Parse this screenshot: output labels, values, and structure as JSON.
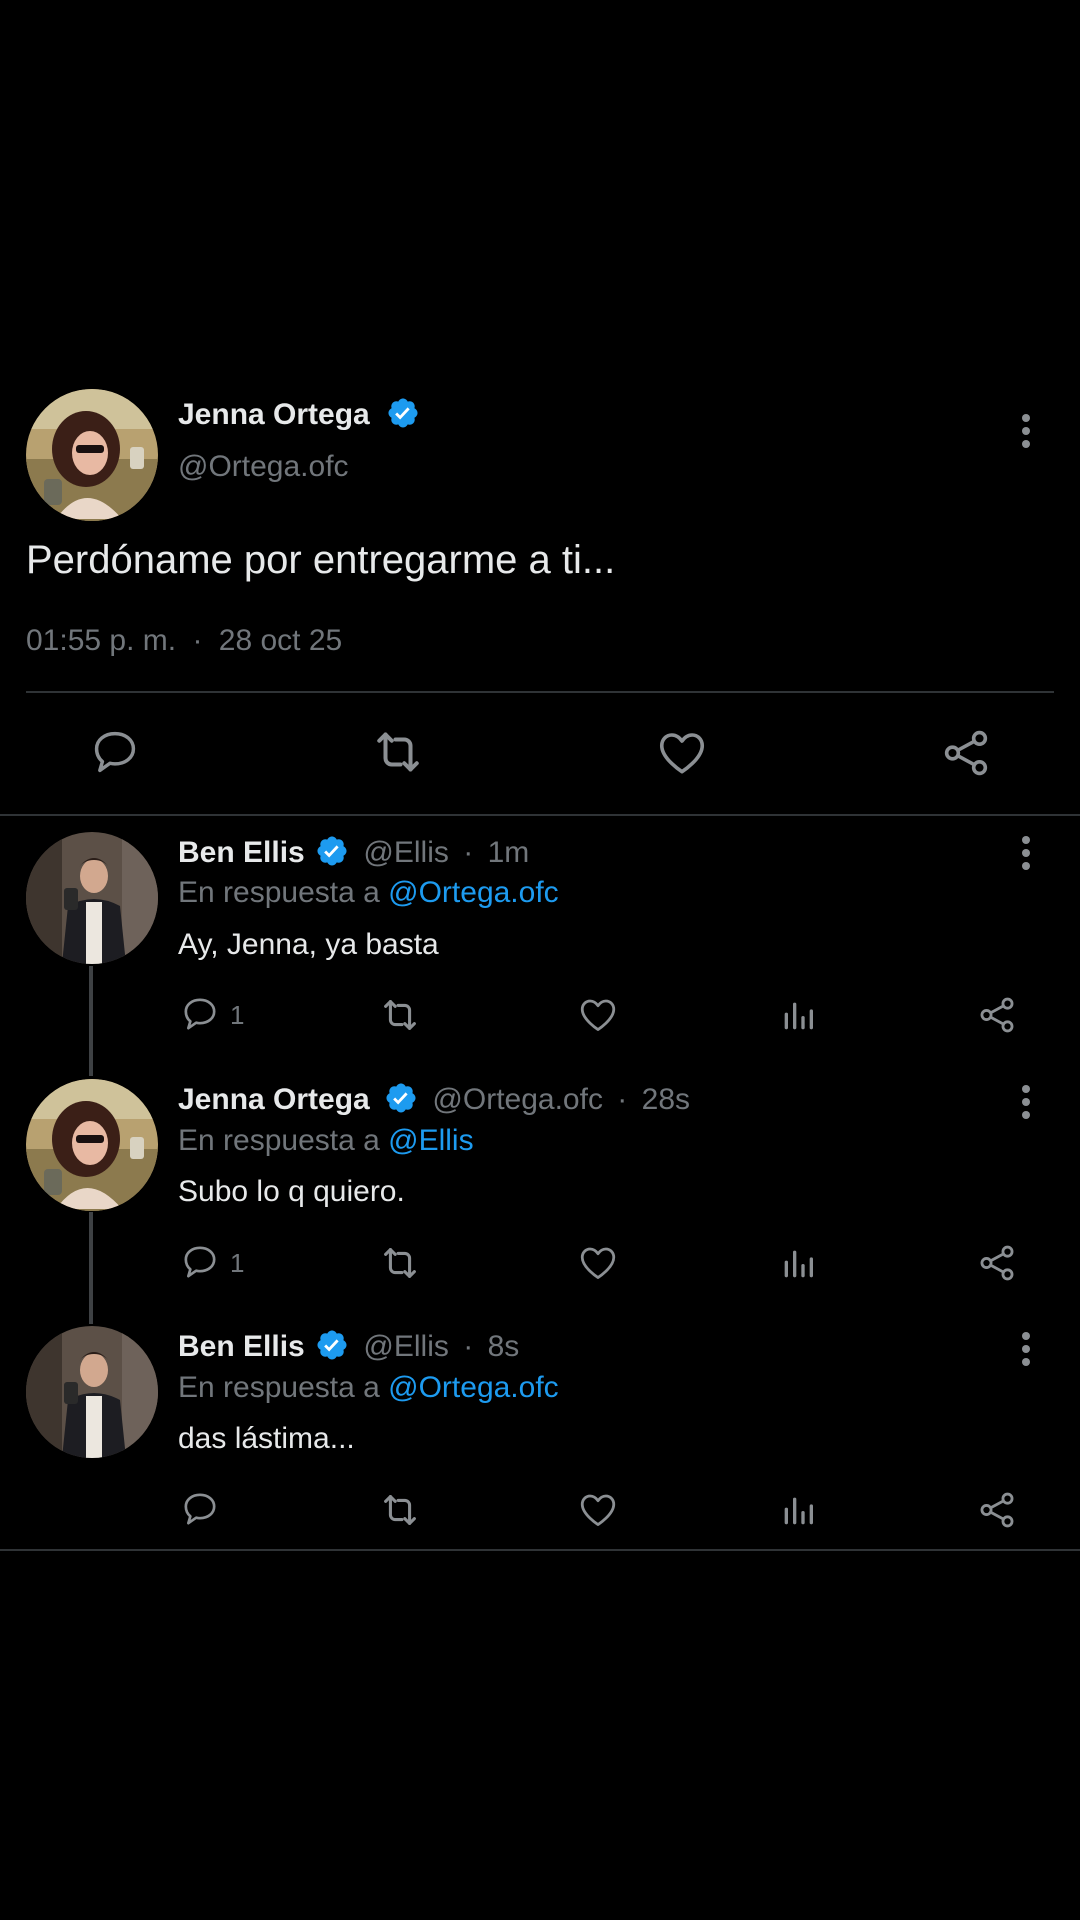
{
  "main_tweet": {
    "author_name": "Jenna Ortega",
    "handle": "@Ortega.ofc",
    "text": "Perdóname por entregarme a ti...",
    "time": "01:55 p. m.",
    "separator": "·",
    "date": "28 oct 25"
  },
  "replies": [
    {
      "author_name": "Ben Ellis",
      "handle": "@Ellis",
      "separator": "·",
      "age": "1m",
      "reply_prefix": "En respuesta a",
      "reply_to": "@Ortega.ofc",
      "text": "Ay, Jenna, ya basta",
      "reply_count": "1"
    },
    {
      "author_name": "Jenna Ortega",
      "handle": "@Ortega.ofc",
      "separator": "·",
      "age": "28s",
      "reply_prefix": "En respuesta a",
      "reply_to": "@Ellis",
      "text": "Subo lo q quiero.",
      "reply_count": "1"
    },
    {
      "author_name": "Ben Ellis",
      "handle": "@Ellis",
      "separator": "·",
      "age": "8s",
      "reply_prefix": "En respuesta a",
      "reply_to": "@Ortega.ofc",
      "text": "das lástima...",
      "reply_count": ""
    }
  ],
  "colors": {
    "background": "#000000",
    "text": "#e7e9ea",
    "secondary": "#71767b",
    "accent": "#1d9bf0",
    "divider": "#2f3336"
  },
  "icons": [
    "verified-badge-icon",
    "more-options-icon",
    "reply-icon",
    "retweet-icon",
    "like-icon",
    "share-icon",
    "views-icon"
  ]
}
